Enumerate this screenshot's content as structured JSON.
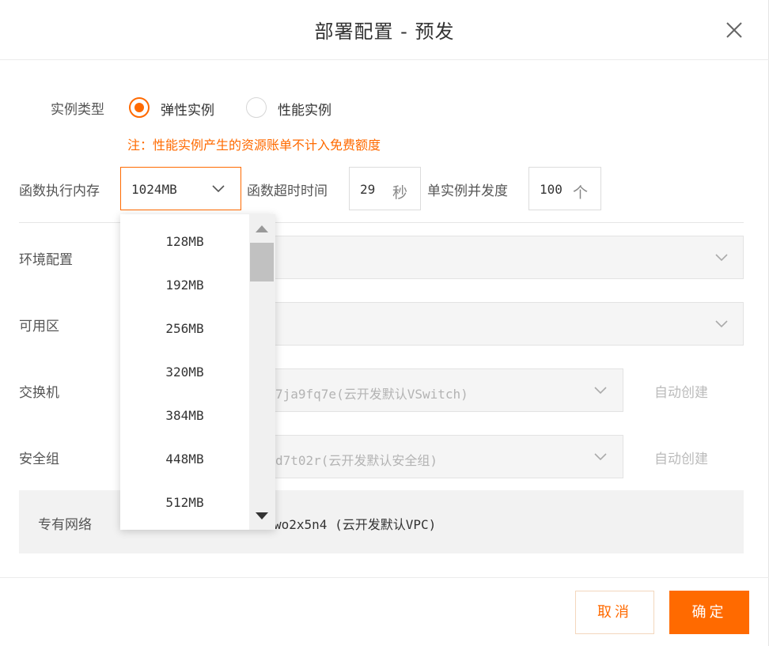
{
  "dialog": {
    "title": "部署配置 - 预发",
    "close_icon": "close-icon"
  },
  "instance": {
    "label": "实例类型",
    "options": [
      {
        "label": "弹性实例",
        "selected": true
      },
      {
        "label": "性能实例",
        "selected": false
      }
    ],
    "note": "注：性能实例产生的资源账单不计入免费额度"
  },
  "memory": {
    "label": "函数执行内存",
    "value": "1024MB",
    "options": [
      "128MB",
      "192MB",
      "256MB",
      "320MB",
      "384MB",
      "448MB",
      "512MB"
    ]
  },
  "timeout": {
    "label": "函数超时时间",
    "value": "29",
    "unit": "秒"
  },
  "concurrency": {
    "label": "单实例并发度",
    "value": "100",
    "unit": "个"
  },
  "env": {
    "label": "环境配置",
    "value": ""
  },
  "zone": {
    "label": "可用区",
    "value": ""
  },
  "vswitch": {
    "label": "交换机",
    "value": "7ja9fq7e(云开发默认VSwitch)",
    "auto_create": "自动创建"
  },
  "security_group": {
    "label": "安全组",
    "value": "d7t02r(云开发默认安全组)",
    "auto_create": "自动创建"
  },
  "vpc": {
    "label": "专有网络",
    "value": "wo2x5n4 (云开发默认VPC)"
  },
  "footer": {
    "cancel": "取消",
    "confirm": "确定"
  },
  "colors": {
    "accent": "#ff6a00",
    "disabled_bg": "#f5f5f5",
    "border": "#dcdcdc"
  }
}
